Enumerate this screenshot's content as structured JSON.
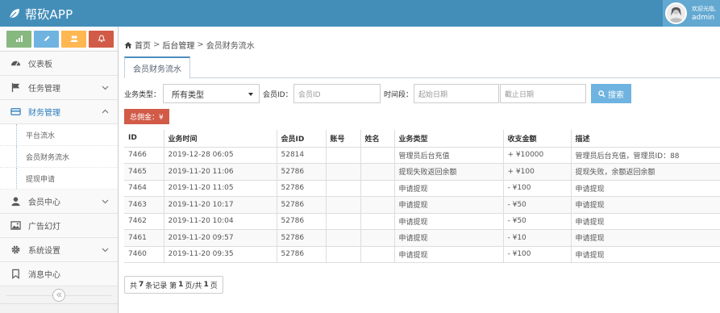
{
  "app": {
    "title": "帮砍APP"
  },
  "user": {
    "welcome": "欢迎光临,",
    "name": "admin"
  },
  "sidebar": {
    "shortcuts": [
      {
        "icon": "signal-icon",
        "color": "#87b87f"
      },
      {
        "icon": "pencil-icon",
        "color": "#6fb3e0"
      },
      {
        "icon": "users-icon",
        "color": "#ffb752"
      },
      {
        "icon": "bell-icon",
        "color": "#d15b47"
      }
    ],
    "items": [
      {
        "label": "仪表板",
        "icon": "dashboard-icon"
      },
      {
        "label": "任务管理",
        "icon": "flag-icon",
        "expandable": true
      },
      {
        "label": "财务管理",
        "icon": "credit-card-icon",
        "expandable": true,
        "active": true
      },
      {
        "label": "平台流水",
        "sub": true
      },
      {
        "label": "会员财务流水",
        "sub": true
      },
      {
        "label": "提现申请",
        "sub": true
      },
      {
        "label": "会员中心",
        "icon": "user-icon",
        "expandable": true
      },
      {
        "label": "广告幻灯",
        "icon": "picture-icon"
      },
      {
        "label": "系统设置",
        "icon": "cog-icon",
        "expandable": true
      },
      {
        "label": "消息中心",
        "icon": "bookmark-icon"
      }
    ]
  },
  "breadcrumb": {
    "home": "首页",
    "level1": "后台管理",
    "level2": "会员财务流水",
    "sep": ">"
  },
  "tab": {
    "label": "会员财务流水"
  },
  "filters": {
    "type_label": "业务类型：",
    "type_value": "所有类型",
    "member_label": "会员ID：",
    "member_placeholder": "会员ID",
    "time_label": "时间段：",
    "start_placeholder": "起始日期",
    "end_placeholder": "截止日期",
    "search_label": "搜索"
  },
  "total": {
    "label": "总佣金：¥"
  },
  "table": {
    "headers": [
      "ID",
      "业务时间",
      "会员ID",
      "账号",
      "姓名",
      "业务类型",
      "收支金额",
      "描述"
    ],
    "rows": [
      [
        "7466",
        "2019-12-28 06:05",
        "52814",
        "",
        "",
        "管理员后台充值",
        "+ ¥10000",
        "管理员后台充值，管理员ID：88"
      ],
      [
        "7465",
        "2019-11-20 11:06",
        "52786",
        "",
        "",
        "提现失败返回余额",
        "+ ¥100",
        "提现失败，余额返回余额"
      ],
      [
        "7464",
        "2019-11-20 11:05",
        "52786",
        "",
        "",
        "申请提现",
        "- ¥100",
        "申请提现"
      ],
      [
        "7463",
        "2019-11-20 10:17",
        "52786",
        "",
        "",
        "申请提现",
        "- ¥50",
        "申请提现"
      ],
      [
        "7462",
        "2019-11-20 10:04",
        "52786",
        "",
        "",
        "申请提现",
        "- ¥50",
        "申请提现"
      ],
      [
        "7461",
        "2019-11-20 09:57",
        "52786",
        "",
        "",
        "申请提现",
        "- ¥10",
        "申请提现"
      ],
      [
        "7460",
        "2019-11-20 09:35",
        "52786",
        "",
        "",
        "申请提现",
        "- ¥100",
        "申请提现"
      ]
    ]
  },
  "pagination": {
    "prefix": "共",
    "records": "7",
    "mid1": "条记录 第",
    "page": "1",
    "mid2": "页/共",
    "pages": "1",
    "suffix": "页"
  }
}
